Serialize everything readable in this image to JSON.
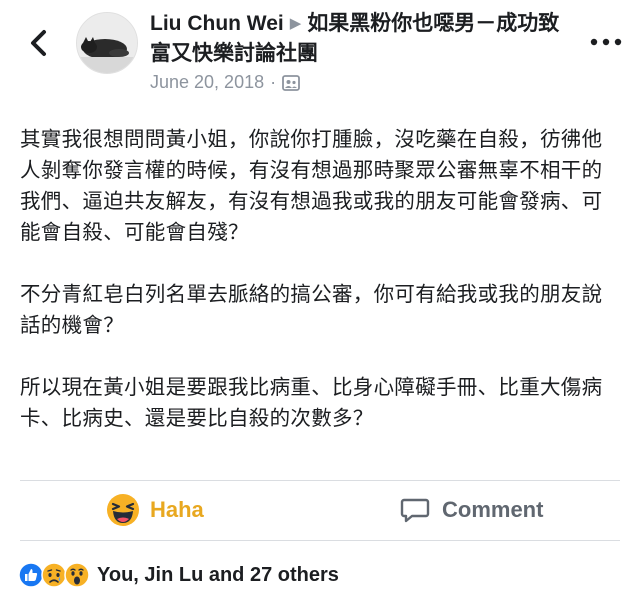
{
  "post": {
    "author": "Liu Chun Wei",
    "group": "如果黑粉你也噁男－成功致富又快樂討論社團",
    "date": "June 20, 2018",
    "separator": "·",
    "body": [
      "其實我很想問問黃小姐，你說你打腫臉，沒吃藥在自殺，彷彿他人剝奪你發言權的時候，有沒有想過那時聚眾公審無辜不相干的我們、逼迫共友解友，有沒有想過我或我的朋友可能會發病、可能會自殺、可能會自殘？",
      "不分青紅皂白列名單去脈絡的搞公審，你可有給我或我的朋友說話的機會？",
      "所以現在黃小姐是要跟我比病重、比身心障礙手冊、比重大傷病卡、比病史、還是要比自殺的次數多？"
    ]
  },
  "actions": {
    "haha_label": "Haha",
    "comment_label": "Comment"
  },
  "reactions": {
    "icons": [
      "like-icon",
      "sad-icon",
      "wow-icon"
    ],
    "summary": "You, Jin Lu and 27 others"
  },
  "colors": {
    "haha": "#e8a820",
    "like": "#1877f2",
    "muted": "#8d949e",
    "divider": "#dadde1"
  }
}
